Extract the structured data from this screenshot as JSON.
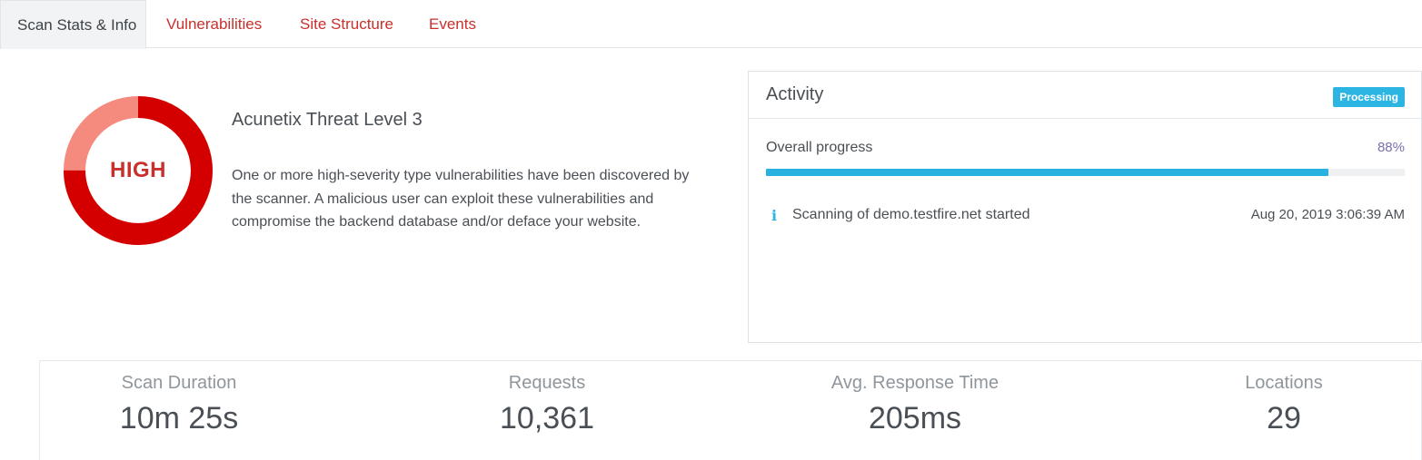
{
  "tabs": [
    {
      "label": "Scan Stats & Info",
      "active": true
    },
    {
      "label": "Vulnerabilities",
      "active": false
    },
    {
      "label": "Site Structure",
      "active": false
    },
    {
      "label": "Events",
      "active": false
    }
  ],
  "threat": {
    "gauge_text": "HIGH",
    "level": 3,
    "level_max": 4,
    "title": "Acunetix Threat Level 3",
    "description": "One or more high-severity type vulnerabilities have been discovered by the scanner. A malicious user can exploit these vulnerabilities and compromise the backend database and/or deface your website.",
    "colors": {
      "high": "#d40000",
      "remaining": "#f58a7f"
    }
  },
  "activity": {
    "title": "Activity",
    "status_badge": "Processing",
    "progress_label": "Overall progress",
    "progress_text": "88%",
    "progress_percent": 88,
    "events": [
      {
        "icon": "info-icon",
        "text": "Scanning of demo.testfire.net started",
        "time": "Aug 20, 2019 3:06:39 AM"
      }
    ]
  },
  "stats": [
    {
      "label": "Scan Duration",
      "value": "10m 25s"
    },
    {
      "label": "Requests",
      "value": "10,361"
    },
    {
      "label": "Avg. Response Time",
      "value": "205ms"
    },
    {
      "label": "Locations",
      "value": "29"
    }
  ],
  "colors": {
    "accent": "#29b2e0",
    "tab_link": "#c9302c",
    "progress_value": "#7b6fb0"
  }
}
